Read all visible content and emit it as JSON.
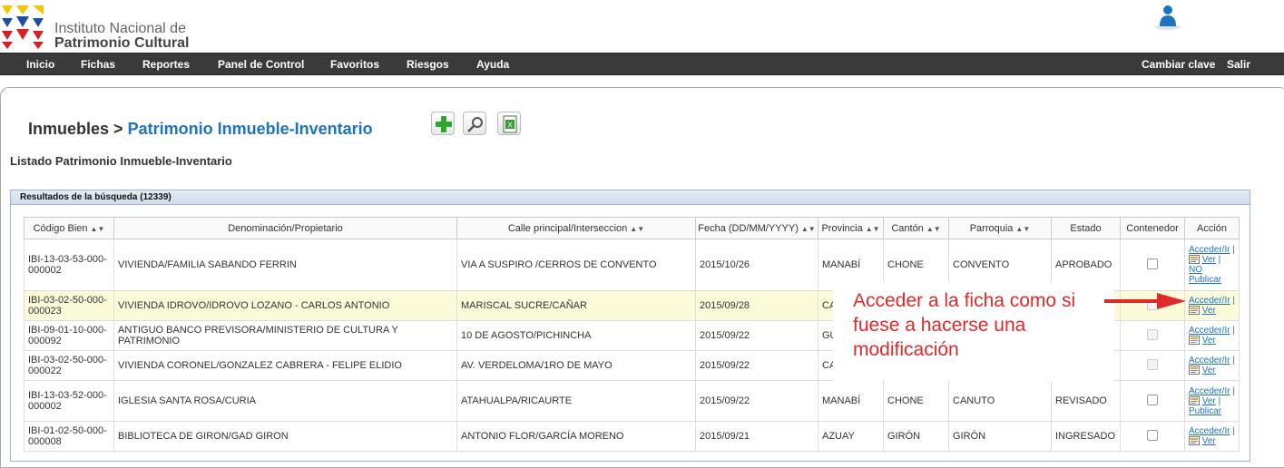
{
  "header": {
    "logo_line1": "Instituto Nacional de",
    "logo_line2": "Patrimonio Cultural"
  },
  "nav": {
    "items": [
      "Inicio",
      "Fichas",
      "Reportes",
      "Panel de Control",
      "Favoritos",
      "Riesgos",
      "Ayuda"
    ],
    "right": [
      "Cambiar clave",
      "Salir"
    ]
  },
  "page": {
    "breadcrumb_root": "Inmuebles >",
    "breadcrumb_current": "Patrimonio Inmueble-Inventario",
    "subtitle": "Listado Patrimonio Inmueble-Inventario",
    "toolbar_icons": [
      "add-icon",
      "search-icon",
      "excel-export-icon"
    ]
  },
  "results": {
    "title": "Resultados de la búsqueda (12339)",
    "columns": [
      "Código Bien",
      "Denominación/Propietario",
      "Calle principal/Interseccion",
      "Fecha (DD/MM/YYYY)",
      "Provincia",
      "Cantón",
      "Parroquia",
      "Estado",
      "Contenedor",
      "Acción"
    ],
    "rows": [
      {
        "codigo": "IBI-13-03-53-000-000002",
        "denominacion": "VIVIENDA/FAMILIA SABANDO FERRIN",
        "calle": "VIA A SUSPIRO /CERROS DE CONVENTO",
        "fecha": "2015/10/26",
        "provincia": "MANABÍ",
        "canton": "CHONE",
        "parroquia": "CONVENTO",
        "estado": "APROBADO",
        "acceder": "Acceder/Ir",
        "ver": "Ver",
        "extra": "NO Publicar"
      },
      {
        "codigo": "IBI-03-02-50-000-000023",
        "denominacion": "VIVIENDA IDROVO/IDROVO LOZANO - CARLOS ANTONIO",
        "calle": "MARISCAL SUCRE/CAÑAR",
        "fecha": "2015/09/28",
        "provincia": "CA",
        "canton": "",
        "parroquia": "",
        "estado": "",
        "acceder": "Acceder/Ir",
        "ver": "Ver",
        "extra": ""
      },
      {
        "codigo": "IBI-09-01-10-000-000092",
        "denominacion": "ANTIGUO BANCO PREVISORA/MINISTERIO DE CULTURA Y PATRIMONIO",
        "calle": "10 DE AGOSTO/PICHINCHA",
        "fecha": "2015/09/22",
        "provincia": "GU",
        "canton": "",
        "parroquia": "",
        "estado": "",
        "acceder": "Acceder/Ir",
        "ver": "Ver",
        "extra": ""
      },
      {
        "codigo": "IBI-03-02-50-000-000022",
        "denominacion": "VIVIENDA CORONEL/GONZALEZ CABRERA - FELIPE ELIDIO",
        "calle": "AV. VERDELOMA/1RO DE MAYO",
        "fecha": "2015/09/22",
        "provincia": "CA",
        "canton": "",
        "parroquia": "",
        "estado": "",
        "acceder": "Acceder/Ir",
        "ver": "Ver",
        "extra": ""
      },
      {
        "codigo": "IBI-13-03-52-000-000002",
        "denominacion": "IGLESIA SANTA ROSA/CURIA",
        "calle": "ATAHUALPA/RICAURTE",
        "fecha": "2015/09/22",
        "provincia": "MANABÍ",
        "canton": "CHONE",
        "parroquia": "CANUTO",
        "estado": "REVISADO",
        "acceder": "Acceder/Ir",
        "ver": "Ver",
        "extra": "Publicar"
      },
      {
        "codigo": "IBI-01-02-50-000-000008",
        "denominacion": "BIBLIOTECA DE GIRON/GAD GIRON",
        "calle": "ANTONIO FLOR/GARCÍA MORENO",
        "fecha": "2015/09/21",
        "provincia": "AZUAY",
        "canton": "GIRÓN",
        "parroquia": "GIRÓN",
        "estado": "INGRESADO",
        "acceder": "Acceder/Ir",
        "ver": "Ver",
        "extra": ""
      }
    ]
  },
  "annotation": {
    "text": "Acceder a la ficha como si fuese a hacerse una modificación",
    "color": "#e02a2a"
  },
  "colors": {
    "nav_bg": "#3a3a3a",
    "link": "#1e73be",
    "highlight_row": "#fbfbd9"
  }
}
